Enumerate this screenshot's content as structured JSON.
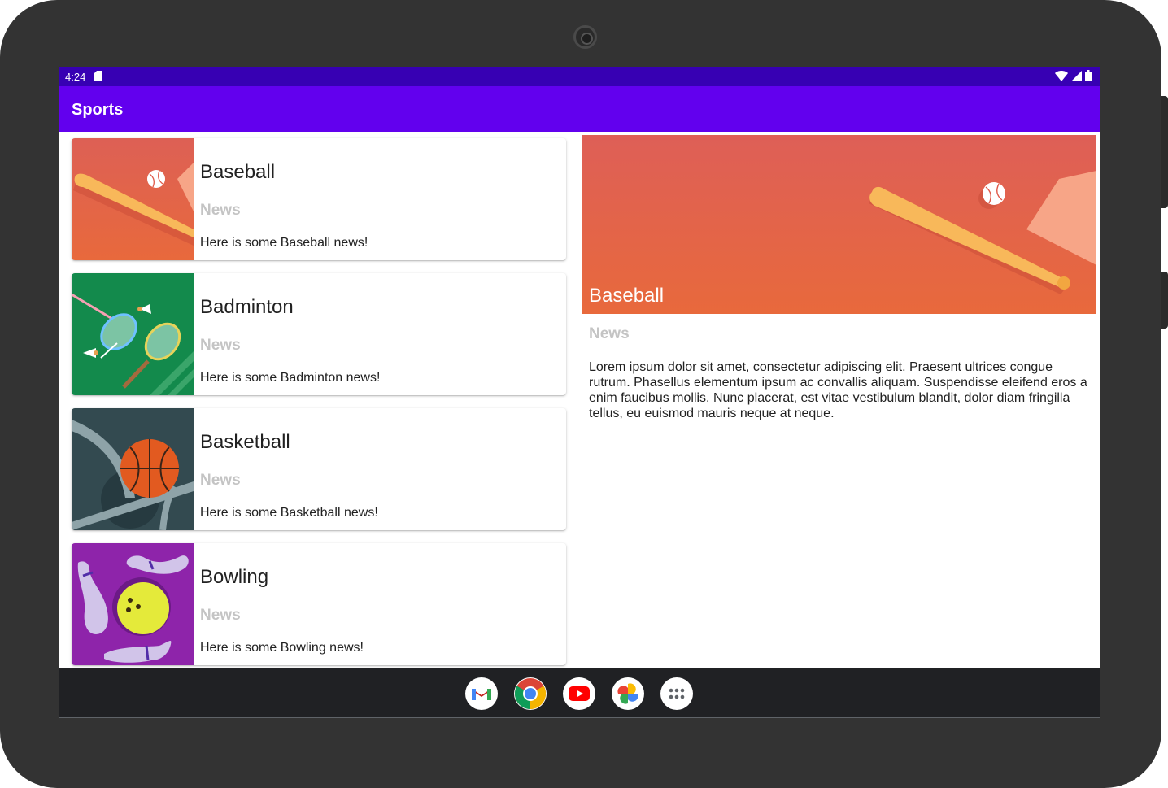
{
  "status_bar": {
    "time": "4:24"
  },
  "app_bar": {
    "title": "Sports"
  },
  "sports": [
    {
      "title": "Baseball",
      "subtitle": "News",
      "description": "Here is some Baseball news!",
      "image": "baseball-illustration"
    },
    {
      "title": "Badminton",
      "subtitle": "News",
      "description": "Here is some Badminton news!",
      "image": "badminton-illustration"
    },
    {
      "title": "Basketball",
      "subtitle": "News",
      "description": "Here is some Basketball news!",
      "image": "basketball-illustration"
    },
    {
      "title": "Bowling",
      "subtitle": "News",
      "description": "Here is some Bowling news!",
      "image": "bowling-illustration"
    }
  ],
  "detail": {
    "title": "Baseball",
    "subtitle": "News",
    "body": "Lorem ipsum dolor sit amet, consectetur adipiscing elit. Praesent ultrices congue rutrum. Phasellus elementum ipsum ac convallis aliquam. Suspendisse eleifend eros a enim faucibus mollis. Nunc placerat, est vitae vestibulum blandit, dolor diam fringilla tellus, eu euismod mauris neque at neque.",
    "image": "baseball-illustration"
  },
  "dock": [
    {
      "name": "gmail-icon"
    },
    {
      "name": "chrome-icon"
    },
    {
      "name": "youtube-icon"
    },
    {
      "name": "photos-icon"
    },
    {
      "name": "app-drawer-icon"
    }
  ],
  "colors": {
    "status_bar": "#3700b3",
    "app_bar": "#6200ee",
    "subtitle": "#c4c4c4"
  }
}
